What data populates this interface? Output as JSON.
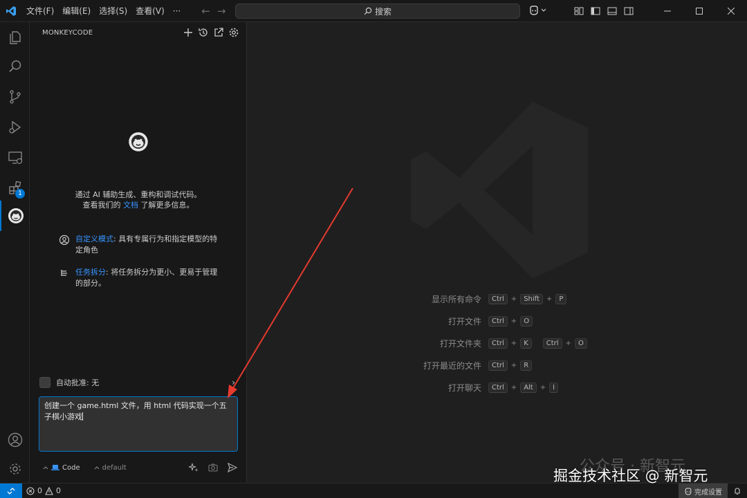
{
  "titlebar": {
    "menu": [
      "文件(F)",
      "编辑(E)",
      "选择(S)",
      "查看(V)",
      "···"
    ],
    "search_placeholder": "搜索"
  },
  "activity": {
    "extensions_badge": "1"
  },
  "sidebar": {
    "title": "MONKEYCODE",
    "intro_line1": "通过 AI 辅助生成、重构和调试代码。",
    "intro_line2_pre": "查看我们的 ",
    "intro_link": "文档",
    "intro_line2_post": " 了解更多信息。",
    "features": [
      {
        "key": "自定义模式",
        "text": ": 具有专属行为和指定模型的特定角色"
      },
      {
        "key": "任务拆分",
        "text": ": 将任务拆分为更小、更易于管理的部分。"
      }
    ],
    "auto_approve": "自动批准: 无",
    "chat_input_text": "创建一个 game.html 文件，用 html 代码实现一个五子棋小游戏",
    "mode": "Code",
    "model": "default"
  },
  "shortcuts": [
    {
      "label": "显示所有命令",
      "keys": [
        [
          "Ctrl",
          "Shift",
          "P"
        ]
      ]
    },
    {
      "label": "打开文件",
      "keys": [
        [
          "Ctrl",
          "O"
        ]
      ]
    },
    {
      "label": "打开文件夹",
      "keys": [
        [
          "Ctrl",
          "K"
        ],
        [
          "Ctrl",
          "O"
        ]
      ]
    },
    {
      "label": "打开最近的文件",
      "keys": [
        [
          "Ctrl",
          "R"
        ]
      ]
    },
    {
      "label": "打开聊天",
      "keys": [
        [
          "Ctrl",
          "Alt",
          "I"
        ]
      ]
    }
  ],
  "statusbar": {
    "errors": "0",
    "warnings": "0",
    "setup": "完成设置"
  },
  "watermark": {
    "line1": "公众号 · 新智元",
    "line2": "掘金技术社区 @ 新智元"
  },
  "colors": {
    "accent": "#0078d4",
    "link": "#3794ff",
    "arrow": "#e53a2f"
  }
}
